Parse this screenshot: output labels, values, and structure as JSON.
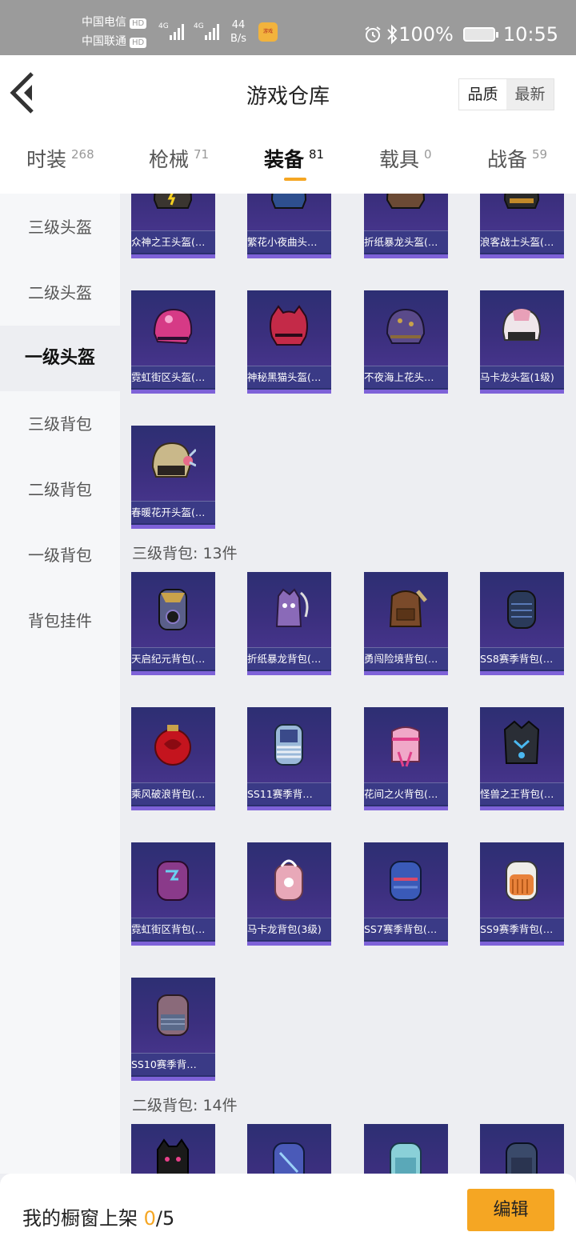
{
  "status": {
    "carrier1": "中国电信",
    "carrier2": "中国联通",
    "hd": "HD",
    "net_type": "4G",
    "speed_value": "44",
    "speed_unit": "B/s",
    "battery": "100%",
    "time": "10:55"
  },
  "header": {
    "title": "游戏仓库",
    "sort_quality": "品质",
    "sort_newest": "最新"
  },
  "tabs": [
    {
      "label": "时装",
      "count": "268"
    },
    {
      "label": "枪械",
      "count": "71"
    },
    {
      "label": "装备",
      "count": "81"
    },
    {
      "label": "载具",
      "count": "0"
    },
    {
      "label": "战备",
      "count": "59"
    }
  ],
  "sidebar": [
    "三级头盔",
    "二级头盔",
    "一级头盔",
    "三级背包",
    "二级背包",
    "一级背包",
    "背包挂件"
  ],
  "sections": {
    "bag3": "三级背包: 13件",
    "bag2": "二级背包: 14件"
  },
  "items": {
    "row0": [
      "众神之王头盔(…",
      "繁花小夜曲头…",
      "折纸暴龙头盔(…",
      "浪客战士头盔(…"
    ],
    "row1": [
      "霓虹街区头盔(…",
      "神秘黑猫头盔(…",
      "不夜海上花头…",
      "马卡龙头盔(1级)"
    ],
    "row2": [
      "春暖花开头盔(…"
    ],
    "row3": [
      "天启纪元背包(…",
      "折纸暴龙背包(…",
      "勇闯险境背包(…",
      "SS8赛季背包(…"
    ],
    "row4": [
      "乘风破浪背包(…",
      "SS11赛季背…",
      "花间之火背包(…",
      "怪兽之王背包(…"
    ],
    "row5": [
      "霓虹街区背包(…",
      "马卡龙背包(3级)",
      "SS7赛季背包(…",
      "SS9赛季背包(…"
    ],
    "row6": [
      "SS10赛季背…"
    ]
  },
  "bottom": {
    "shelf_label": "我的橱窗上架",
    "shelf_count": "0",
    "shelf_total": "/5",
    "edit": "编辑"
  },
  "colors": {
    "accent": "#f5a623",
    "card_bg": "#2d2f73",
    "card_bar": "#7e62d8"
  }
}
